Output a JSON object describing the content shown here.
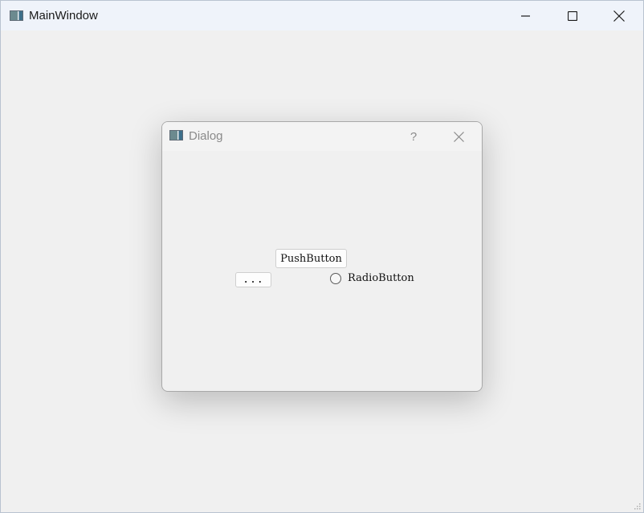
{
  "main_window": {
    "title": "MainWindow",
    "icon": "app-window-icon",
    "controls": {
      "minimize_icon": "minimize-icon",
      "maximize_icon": "maximize-icon",
      "close_icon": "close-icon"
    }
  },
  "dialog": {
    "title": "Dialog",
    "icon": "app-window-icon",
    "help_label": "?",
    "close_icon": "close-icon",
    "push_button_label": "PushButton",
    "tool_button_label": "...",
    "radio_button_label": "RadioButton",
    "radio_checked": false
  },
  "colors": {
    "window_background": "#f0f0f0",
    "main_titlebar": "#eff3fa",
    "dialog_title_text": "#8a8a8a"
  }
}
